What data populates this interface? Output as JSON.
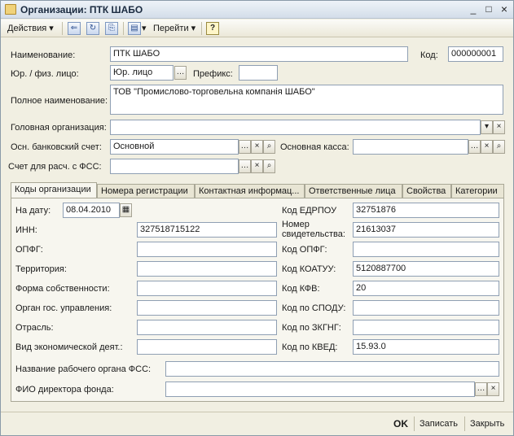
{
  "window": {
    "title": "Организации: ПТК ШАБО",
    "minimize": "_",
    "maximize": "□",
    "close": "×"
  },
  "toolbar": {
    "actions": "Действия",
    "goto": "Перейти",
    "help": "?"
  },
  "form": {
    "name_label": "Наименование:",
    "name_value": "ПТК ШАБО",
    "code_label": "Код:",
    "code_value": "000000001",
    "type_label": "Юр. / физ. лицо:",
    "type_value": "Юр. лицо",
    "prefix_label": "Префикс:",
    "prefix_value": "",
    "fullname_label": "Полное наименование:",
    "fullname_value": "ТОВ \"Промислово-торговельна компанія ШАБО\"",
    "head_label": "Головная организация:",
    "head_value": "",
    "bank_label": "Осн. банковский счет:",
    "bank_value": "Основной",
    "cash_label": "Основная касса:",
    "cash_value": "",
    "fss_label": "Счет для расч. с ФСС:",
    "fss_value": ""
  },
  "tabs": [
    "Коды организации",
    "Номера регистрации",
    "Контактная информац...",
    "Ответственные лица",
    "Свойства",
    "Категории"
  ],
  "codes": {
    "date_label": "На дату:",
    "date_value": "08.04.2010",
    "inn_label": "ИНН:",
    "inn_value": "327518715122",
    "opfg_label": "ОПФГ:",
    "opfg_value": "",
    "territory_label": "Территория:",
    "territory_value": "",
    "ownership_label": "Форма собственности:",
    "ownership_value": "",
    "gov_label": "Орган гос. управления:",
    "gov_value": "",
    "branch_label": "Отрасль:",
    "branch_value": "",
    "activity_label": "Вид экономической деят.:",
    "activity_value": "",
    "edrpou_label": "Код ЕДРПОУ",
    "edrpou_value": "32751876",
    "cert_label_1": "Номер",
    "cert_label_2": "свидетельства:",
    "cert_value": "21613037",
    "kopfg_label": "Код ОПФГ:",
    "kopfg_value": "",
    "koatuu_label": "Код КОАТУУ:",
    "koatuu_value": "5120887700",
    "kfv_label": "Код КФВ:",
    "kfv_value": "20",
    "spodu_label": "Код по СПОДУ:",
    "spodu_value": "",
    "zkgng_label": "Код по ЗКГНГ:",
    "zkgng_value": "",
    "kved_label": "Код по КВЕД:",
    "kved_value": "15.93.0",
    "fss_body_label": "Название рабочего органа ФСС:",
    "fss_body_value": "",
    "director_label": "ФИО директора фонда:",
    "director_value": ""
  },
  "status": {
    "ok": "OK",
    "save": "Записать",
    "close": "Закрыть"
  }
}
